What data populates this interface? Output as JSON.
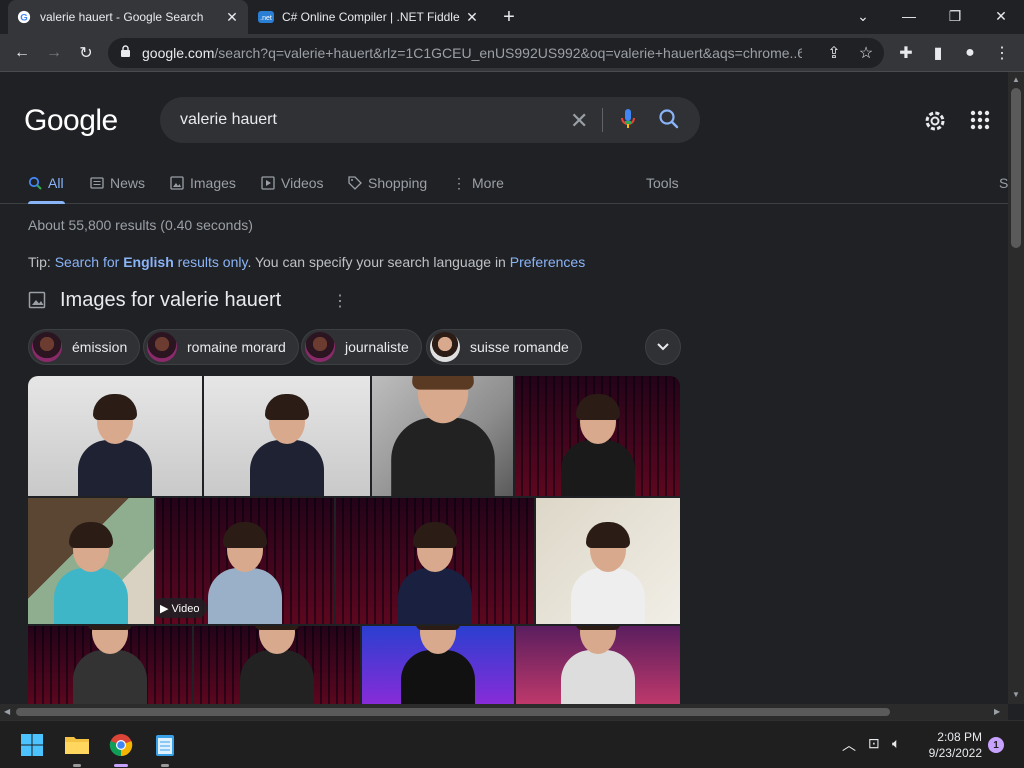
{
  "browser": {
    "tabs": [
      {
        "title": "valerie hauert - Google Search",
        "favicon": "google-icon",
        "active": true
      },
      {
        "title": "C# Online Compiler | .NET Fiddle",
        "favicon": "dotnetfiddle-icon",
        "active": false
      }
    ],
    "new_tab": "+",
    "url_host": "google.com",
    "url_path": "/search?q=valerie+hauert&rlz=1C1GCEU_enUS992US992&oq=valerie+hauert&aqs=chrome..6..."
  },
  "google": {
    "logo": "Google",
    "query": "valerie hauert",
    "nav": {
      "all": "All",
      "news": "News",
      "images": "Images",
      "videos": "Videos",
      "shopping": "Shopping",
      "more": "More",
      "tools": "Tools",
      "cutoff": "S"
    },
    "stats": "About 55,800 results (0.40 seconds)",
    "tip": {
      "prefix": "Tip: ",
      "link1_a": "Search for ",
      "link1_b": "English",
      "link1_c": " results only",
      "middle": ". You can specify your search language in ",
      "link2": "Preferences"
    },
    "images_header": "Images for valerie hauert",
    "chips": [
      "émission",
      "romaine morard",
      "journaliste",
      "suisse romande"
    ],
    "video_badge": "▶ Video"
  },
  "taskbar": {
    "apps": [
      "windows-start-icon",
      "file-explorer-icon",
      "chrome-icon",
      "notepad-icon"
    ],
    "time": "2:08 PM",
    "date": "9/23/2022",
    "notifications": "1"
  }
}
